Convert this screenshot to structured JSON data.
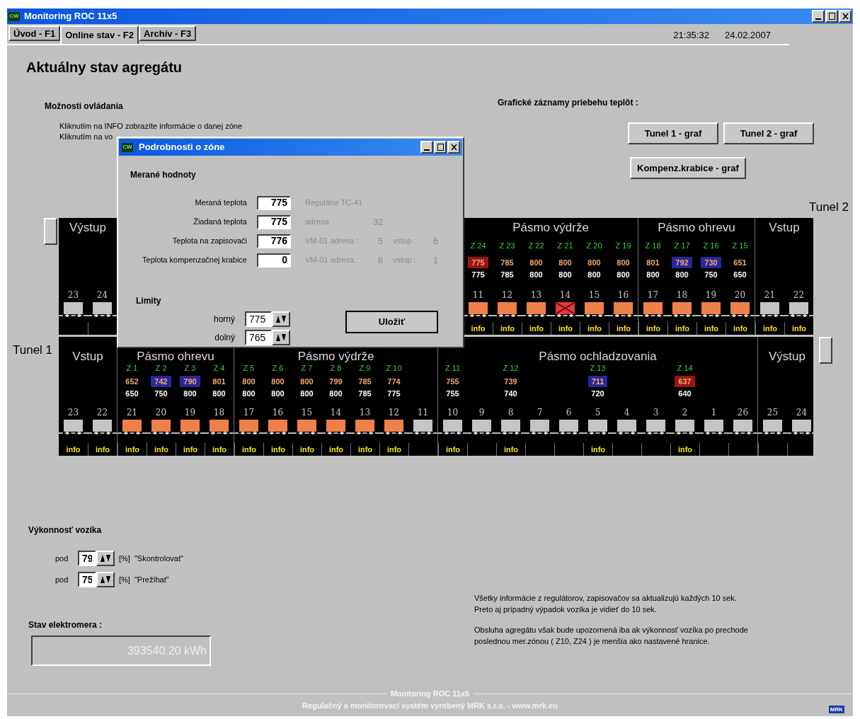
{
  "window": {
    "app_icon": "CW",
    "title": "Monitoring ROC 11x5"
  },
  "tabs": [
    {
      "label": "Úvod - F1",
      "selected": false
    },
    {
      "label": "Online stav - F2",
      "selected": true
    },
    {
      "label": "Archív - F3",
      "selected": false
    }
  ],
  "clock": {
    "time": "21:35:32",
    "date": "24.02.2007"
  },
  "heading": "Aktuálny stav agregátu",
  "controls_help": {
    "title": "Možnosti ovládania",
    "lines": [
      "Kliknutím na INFO zobrazíte informácie o danej zóne",
      "Kliknutím na vo"
    ]
  },
  "graphs": {
    "title": "Grafické záznamy priebehu teplôt :",
    "buttons": [
      "Tunel 1 - graf",
      "Tunel 2 - graf",
      "Kompenz.krabice - graf"
    ]
  },
  "tunnels": [
    {
      "label": "Tunel 2",
      "segments": [
        {
          "sections": [
            {
              "label": "Výstup",
              "cars": [
                {
                  "number": "23",
                  "kind": "empty"
                },
                {
                  "number": "24",
                  "kind": "empty"
                }
              ]
            }
          ]
        },
        {
          "sections": [
            {
              "label": "Pásmo výdrže",
              "cars": [
                {
                  "number": "11",
                  "kind": "loaded",
                  "info": "info",
                  "zone": {
                    "label": "Z 24",
                    "measured": "775",
                    "setpoint": "775",
                    "color": "#9a1414"
                  }
                },
                {
                  "number": "12",
                  "kind": "loaded",
                  "info": "info",
                  "zone": {
                    "label": "Z 23",
                    "measured": "785",
                    "setpoint": "785"
                  }
                },
                {
                  "number": "13",
                  "kind": "loaded",
                  "info": "info",
                  "zone": {
                    "label": "Z 22",
                    "measured": "800",
                    "setpoint": "800"
                  }
                },
                {
                  "number": "14",
                  "kind": "fault",
                  "info": "info",
                  "zone": {
                    "label": "Z 21",
                    "measured": "800",
                    "setpoint": "800"
                  }
                },
                {
                  "number": "15",
                  "kind": "loaded",
                  "info": "info",
                  "zone": {
                    "label": "Z 20",
                    "measured": "800",
                    "setpoint": "800"
                  }
                },
                {
                  "number": "16",
                  "kind": "loaded",
                  "info": "info",
                  "zone": {
                    "label": "Z 19",
                    "measured": "800",
                    "setpoint": "800"
                  }
                }
              ]
            },
            {
              "label": "Pásmo ohrevu",
              "cars": [
                {
                  "number": "17",
                  "kind": "loaded",
                  "info": "info",
                  "zone": {
                    "label": "Z 18",
                    "measured": "801",
                    "setpoint": "800"
                  }
                },
                {
                  "number": "18",
                  "kind": "loaded",
                  "info": "info",
                  "zone": {
                    "label": "Z 17",
                    "measured": "792",
                    "setpoint": "800",
                    "color": "#28289a"
                  }
                },
                {
                  "number": "19",
                  "kind": "loaded",
                  "info": "info",
                  "zone": {
                    "label": "Z 16",
                    "measured": "730",
                    "setpoint": "750",
                    "color": "#28289a"
                  }
                },
                {
                  "number": "20",
                  "kind": "loaded",
                  "info": "info",
                  "zone": {
                    "label": "Z 15",
                    "measured": "651",
                    "setpoint": "650"
                  }
                }
              ]
            },
            {
              "label": "Vstup",
              "cars": [
                {
                  "number": "21",
                  "kind": "empty",
                  "info": "info"
                },
                {
                  "number": "22",
                  "kind": "empty",
                  "info": "info"
                }
              ]
            }
          ]
        }
      ]
    },
    {
      "label": "Tunel 1",
      "segments": [
        {
          "sections": [
            {
              "label": "Vstup",
              "cars": [
                {
                  "number": "23",
                  "kind": "empty",
                  "info": "info"
                },
                {
                  "number": "22",
                  "kind": "empty",
                  "info": "info"
                }
              ]
            },
            {
              "label": "Pásmo ohrevu",
              "cars": [
                {
                  "number": "21",
                  "kind": "loaded",
                  "info": "info",
                  "zone": {
                    "label": "Z 1",
                    "measured": "652",
                    "setpoint": "650"
                  }
                },
                {
                  "number": "20",
                  "kind": "loaded",
                  "info": "info",
                  "zone": {
                    "label": "Z 2",
                    "measured": "742",
                    "setpoint": "750",
                    "color": "#28289a"
                  }
                },
                {
                  "number": "19",
                  "kind": "loaded",
                  "info": "info",
                  "zone": {
                    "label": "Z 3",
                    "measured": "790",
                    "setpoint": "800",
                    "color": "#28289a"
                  }
                },
                {
                  "number": "18",
                  "kind": "loaded",
                  "info": "info",
                  "zone": {
                    "label": "Z 4",
                    "measured": "801",
                    "setpoint": "800"
                  }
                }
              ]
            },
            {
              "label": "Pásmo výdrže",
              "cars": [
                {
                  "number": "17",
                  "kind": "loaded",
                  "info": "info",
                  "zone": {
                    "label": "Z 5",
                    "measured": "800",
                    "setpoint": "800"
                  }
                },
                {
                  "number": "16",
                  "kind": "loaded",
                  "info": "info",
                  "zone": {
                    "label": "Z 6",
                    "measured": "800",
                    "setpoint": "800"
                  }
                },
                {
                  "number": "15",
                  "kind": "loaded",
                  "info": "info",
                  "zone": {
                    "label": "Z 7",
                    "measured": "800",
                    "setpoint": "800"
                  }
                },
                {
                  "number": "14",
                  "kind": "loaded",
                  "info": "info",
                  "zone": {
                    "label": "Z 8",
                    "measured": "799",
                    "setpoint": "800"
                  }
                },
                {
                  "number": "13",
                  "kind": "loaded",
                  "info": "info",
                  "zone": {
                    "label": "Z 9",
                    "measured": "785",
                    "setpoint": "785"
                  }
                },
                {
                  "number": "12",
                  "kind": "loaded",
                  "info": "info",
                  "zone": {
                    "label": "Z 10",
                    "measured": "774",
                    "setpoint": "775"
                  }
                },
                {
                  "number": "11",
                  "kind": "empty"
                }
              ]
            },
            {
              "label": "Pásmo ochladzovania",
              "cars": [
                {
                  "number": "10",
                  "kind": "empty",
                  "info": "info",
                  "zone": {
                    "label": "Z 11",
                    "measured": "755",
                    "setpoint": "755"
                  }
                },
                {
                  "number": "9",
                  "kind": "empty"
                },
                {
                  "number": "8",
                  "kind": "empty",
                  "info": "info",
                  "zone": {
                    "label": "Z 12",
                    "measured": "739",
                    "setpoint": "740"
                  }
                },
                {
                  "number": "7",
                  "kind": "empty"
                },
                {
                  "number": "6",
                  "kind": "empty"
                },
                {
                  "number": "5",
                  "kind": "empty",
                  "info": "info",
                  "zone": {
                    "label": "Z 13",
                    "measured": "711",
                    "setpoint": "720",
                    "color": "#28289a"
                  }
                },
                {
                  "number": "4",
                  "kind": "empty"
                },
                {
                  "number": "3",
                  "kind": "empty"
                },
                {
                  "number": "2",
                  "kind": "empty",
                  "info": "info",
                  "zone": {
                    "label": "Z 14",
                    "measured": "637",
                    "setpoint": "640",
                    "color": "#9a1414"
                  }
                },
                {
                  "number": "1",
                  "kind": "empty"
                },
                {
                  "number": "26",
                  "kind": "empty"
                }
              ]
            },
            {
              "label": "Výstup",
              "cars": [
                {
                  "number": "25",
                  "kind": "empty"
                },
                {
                  "number": "24",
                  "kind": "empty"
                }
              ]
            }
          ]
        }
      ]
    }
  ],
  "zone_dialog": {
    "app_icon": "CW",
    "title": "Podrobnosti o zóne",
    "measured_title": "Merané hodnoty",
    "rows": [
      {
        "label": "Meraná teplota",
        "value": "775",
        "notes": [
          "Regulátor TC-41"
        ]
      },
      {
        "label": "Žiadaná teplota",
        "value": "775",
        "notes": [
          "adresa",
          "32"
        ]
      },
      {
        "label": "Teplota na zapisovači",
        "value": "776",
        "notes": [
          "VM-01 adresa :",
          "5",
          "vstup :",
          "6"
        ]
      },
      {
        "label": "Teplota kompenzačnej krabice",
        "value": "0",
        "notes": [
          "VM-01 adresa :",
          "8",
          "vstup :",
          "1"
        ]
      }
    ],
    "limits_title": "Limity",
    "limits": [
      {
        "label": "horný",
        "value": "775"
      },
      {
        "label": "dolný",
        "value": "765"
      }
    ],
    "save": "Uložiť"
  },
  "cart_performance": {
    "title": "Výkonnosť vozíka",
    "rows": [
      {
        "prefix": "pod",
        "value": "79",
        "unit": "[%]",
        "label": "\"Skontrolovat\""
      },
      {
        "prefix": "pod",
        "value": "75",
        "unit": "[%]",
        "label": "\"Prežíhat\""
      }
    ]
  },
  "meter": {
    "title": "Stav elektromera :",
    "value": "393540.20 kWh"
  },
  "notes": [
    [
      "Všetky informácie z regulátorov, zapisovačov sa aktualizujú každých 10 sek.",
      "Preto aj prípadný výpadok vozíka je vidieť do 10 sek."
    ],
    [
      "Obsluha agregátu však bude upozornená iba ak výkonnosť vozíka po prechode",
      "poslednou mer.zónou ( Z10, Z24 ) je menšia ako nastavené hranice."
    ]
  ],
  "footer": {
    "title": "Monitoring ROC 11x5",
    "credit": "Regulačný a monitorovací systém vyrobený MRK s.r.o. - www.mrk.eu",
    "logo": "MRK"
  }
}
